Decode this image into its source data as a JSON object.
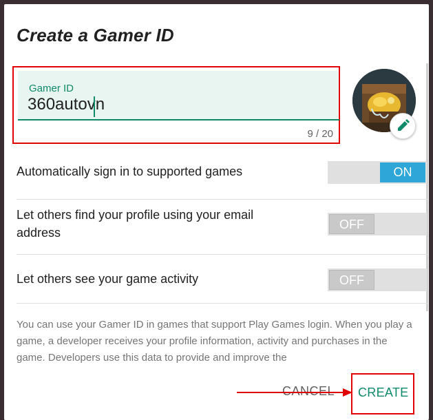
{
  "dialog": {
    "title": "Create a Gamer ID",
    "gamer_id": {
      "label": "Gamer ID",
      "value": "360autovn",
      "counter": "9 / 20"
    },
    "settings": [
      {
        "label": "Automatically sign in to supported games",
        "state": "ON"
      },
      {
        "label": "Let others find your profile using your email address",
        "state": "OFF"
      },
      {
        "label": "Let others see your game activity",
        "state": "OFF"
      }
    ],
    "info_text": "You can use your Gamer ID in games that support Play Games login. When you play a game, a developer receives your profile information, activity and purchases in the game. Developers use this data to provide and improve the",
    "buttons": {
      "cancel": "CANCEL",
      "create": "CREATE"
    }
  },
  "colors": {
    "accent": "#0f8a68",
    "toggle_on": "#2ea6d8",
    "highlight": "#e00000"
  },
  "icons": {
    "avatar": "treasure-chest-avatar",
    "edit": "pencil-icon"
  }
}
